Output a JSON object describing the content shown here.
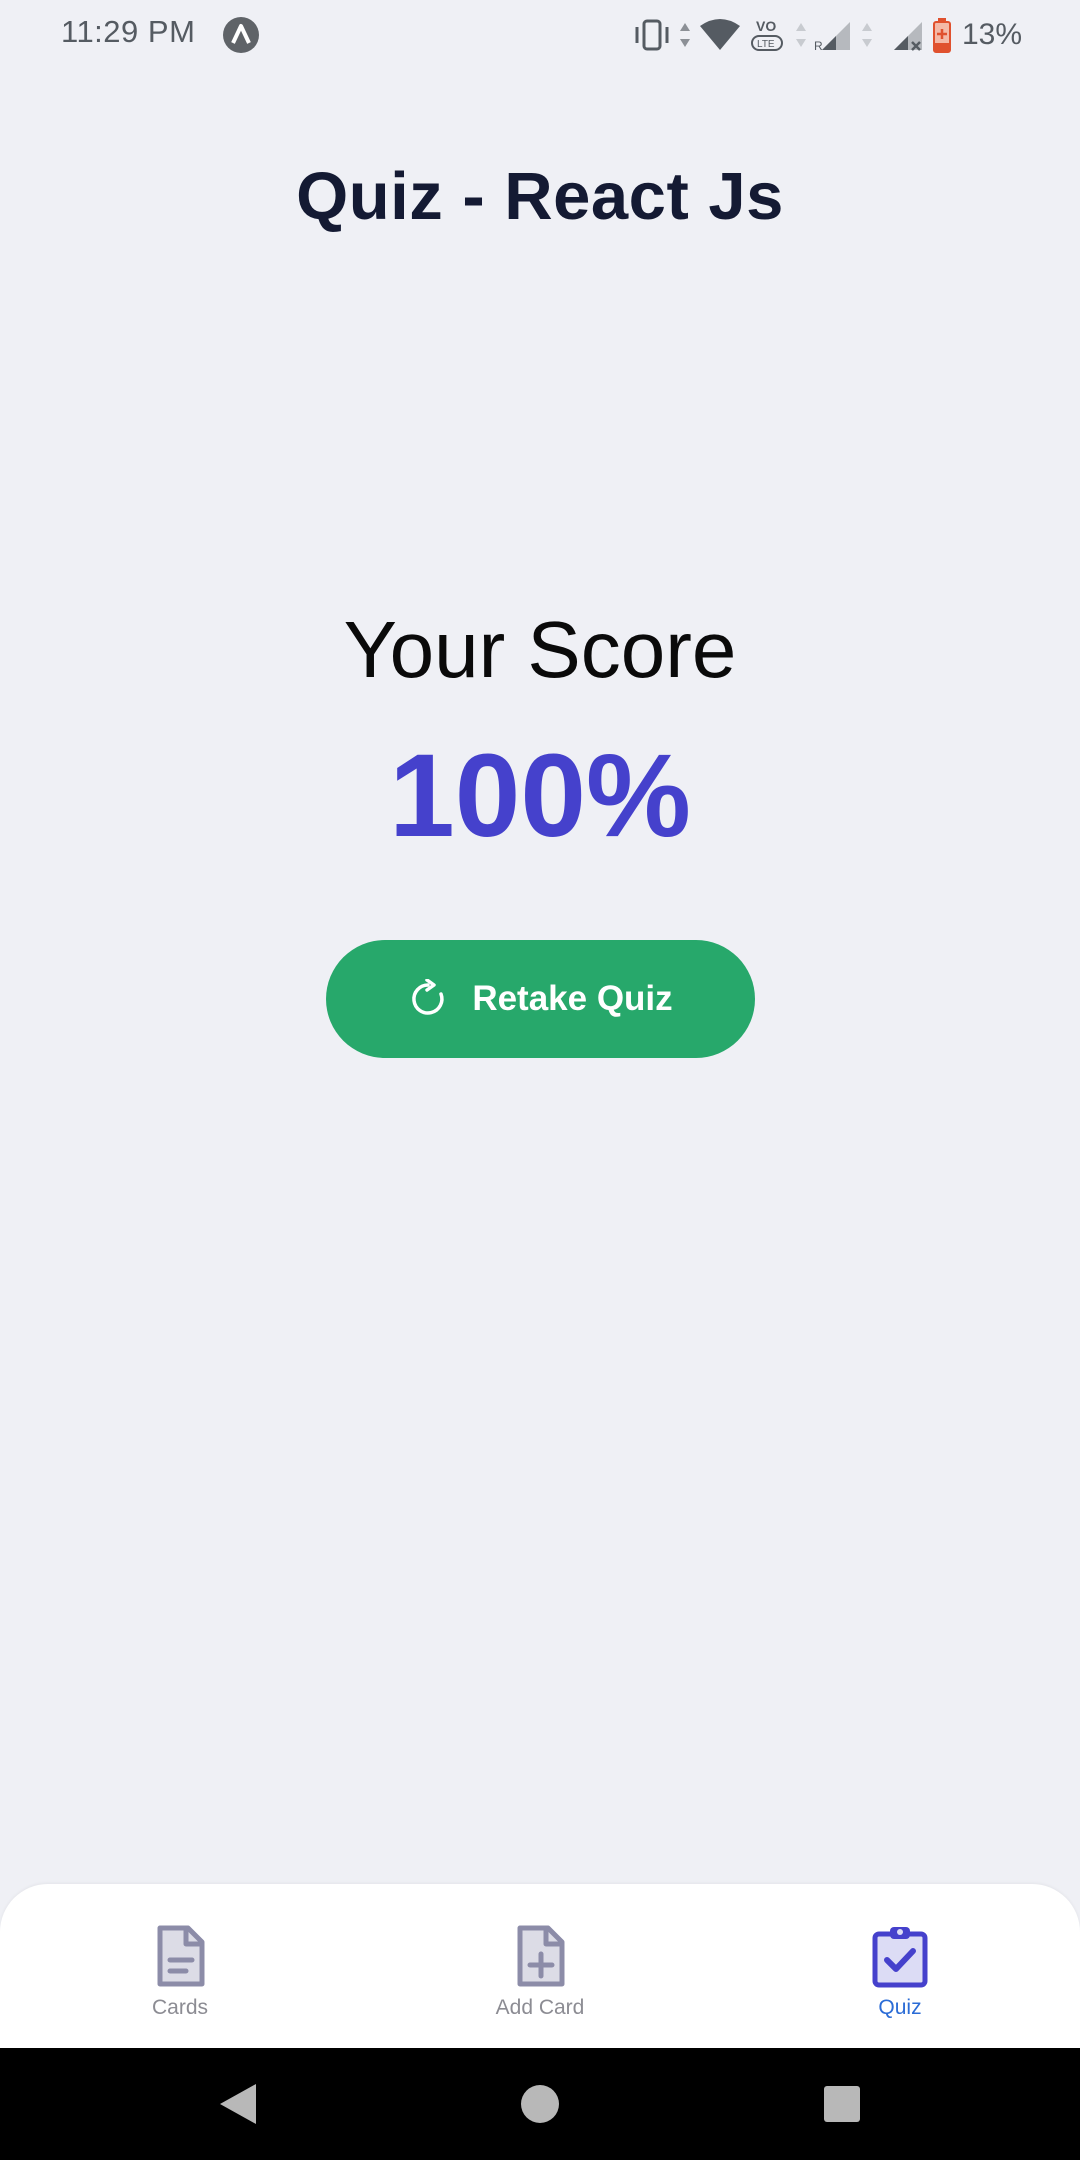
{
  "status_bar": {
    "time": "11:29 PM",
    "battery_percent": "13%",
    "icons": [
      "notification-app-icon",
      "vibrate-icon",
      "wifi-icon",
      "volte-icon",
      "signal-roaming-icon",
      "signal-icon",
      "battery-low-icon"
    ]
  },
  "header": {
    "title": "Quiz - React Js"
  },
  "result": {
    "label": "Your Score",
    "score": "100%",
    "retake_label": "Retake Quiz",
    "retake_icon": "refresh-icon"
  },
  "tabs": [
    {
      "label": "Cards",
      "icon": "document-icon",
      "active": false
    },
    {
      "label": "Add Card",
      "icon": "document-add-icon",
      "active": false
    },
    {
      "label": "Quiz",
      "icon": "clipboard-check-icon",
      "active": true
    }
  ],
  "colors": {
    "background": "#eff0f5",
    "title": "#141a33",
    "score": "#4541cc",
    "button": "#27a86b",
    "tab_active": "#2b6cd6",
    "tab_icon_active": "#4541cc",
    "tab_inactive": "#8c8c93"
  }
}
